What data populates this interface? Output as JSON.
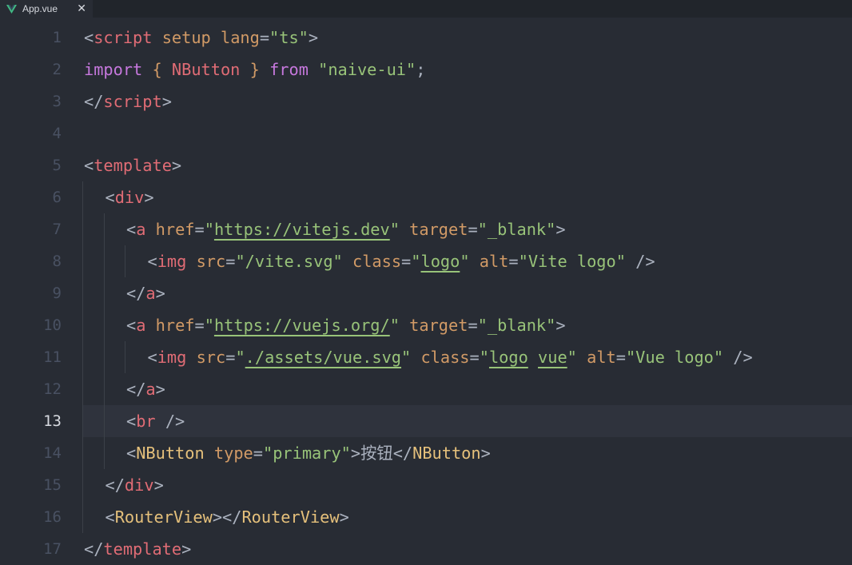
{
  "tab": {
    "filename": "App.vue",
    "close_glyph": "✕",
    "icon": "vue-icon"
  },
  "editor": {
    "current_line": 13,
    "lines": [
      {
        "n": "1",
        "indent": 0,
        "tokens": [
          [
            "pun",
            "<"
          ],
          [
            "tag",
            "script"
          ],
          [
            "pun",
            " "
          ],
          [
            "att",
            "setup"
          ],
          [
            "pun",
            " "
          ],
          [
            "att",
            "lang"
          ],
          [
            "pun",
            "="
          ],
          [
            "str",
            "\"ts\""
          ],
          [
            "pun",
            ">"
          ]
        ]
      },
      {
        "n": "2",
        "indent": 0,
        "tokens": [
          [
            "kw",
            "import"
          ],
          [
            "pun",
            " "
          ],
          [
            "att",
            "{"
          ],
          [
            "pun",
            " "
          ],
          [
            "tag",
            "NButton"
          ],
          [
            "pun",
            " "
          ],
          [
            "att",
            "}"
          ],
          [
            "pun",
            " "
          ],
          [
            "kw",
            "from"
          ],
          [
            "pun",
            " "
          ],
          [
            "str",
            "\"naive-ui\""
          ],
          [
            "pun",
            ";"
          ]
        ]
      },
      {
        "n": "3",
        "indent": 0,
        "tokens": [
          [
            "pun",
            "</"
          ],
          [
            "tag",
            "script"
          ],
          [
            "pun",
            ">"
          ]
        ]
      },
      {
        "n": "4",
        "indent": 0,
        "tokens": []
      },
      {
        "n": "5",
        "indent": 0,
        "tokens": [
          [
            "pun",
            "<"
          ],
          [
            "tag",
            "template"
          ],
          [
            "pun",
            ">"
          ]
        ]
      },
      {
        "n": "6",
        "indent": 1,
        "tokens": [
          [
            "pun",
            "<"
          ],
          [
            "tag",
            "div"
          ],
          [
            "pun",
            ">"
          ]
        ]
      },
      {
        "n": "7",
        "indent": 2,
        "tokens": [
          [
            "pun",
            "<"
          ],
          [
            "tag",
            "a"
          ],
          [
            "pun",
            " "
          ],
          [
            "att",
            "href"
          ],
          [
            "pun",
            "="
          ],
          [
            "str",
            "\""
          ],
          [
            "stru",
            "https://vitejs.dev"
          ],
          [
            "str",
            "\""
          ],
          [
            "pun",
            " "
          ],
          [
            "att",
            "target"
          ],
          [
            "pun",
            "="
          ],
          [
            "str",
            "\"_blank\""
          ],
          [
            "pun",
            ">"
          ]
        ]
      },
      {
        "n": "8",
        "indent": 3,
        "tokens": [
          [
            "pun",
            "<"
          ],
          [
            "tag",
            "img"
          ],
          [
            "pun",
            " "
          ],
          [
            "att",
            "src"
          ],
          [
            "pun",
            "="
          ],
          [
            "str",
            "\"/vite.svg\""
          ],
          [
            "pun",
            " "
          ],
          [
            "att",
            "class"
          ],
          [
            "pun",
            "="
          ],
          [
            "str",
            "\""
          ],
          [
            "stru",
            "logo"
          ],
          [
            "str",
            "\""
          ],
          [
            "pun",
            " "
          ],
          [
            "att",
            "alt"
          ],
          [
            "pun",
            "="
          ],
          [
            "str",
            "\"Vite logo\""
          ],
          [
            "pun",
            " />"
          ]
        ]
      },
      {
        "n": "9",
        "indent": 2,
        "tokens": [
          [
            "pun",
            "</"
          ],
          [
            "tag",
            "a"
          ],
          [
            "pun",
            ">"
          ]
        ]
      },
      {
        "n": "10",
        "indent": 2,
        "tokens": [
          [
            "pun",
            "<"
          ],
          [
            "tag",
            "a"
          ],
          [
            "pun",
            " "
          ],
          [
            "att",
            "href"
          ],
          [
            "pun",
            "="
          ],
          [
            "str",
            "\""
          ],
          [
            "stru",
            "https://vuejs.org/"
          ],
          [
            "str",
            "\""
          ],
          [
            "pun",
            " "
          ],
          [
            "att",
            "target"
          ],
          [
            "pun",
            "="
          ],
          [
            "str",
            "\"_blank\""
          ],
          [
            "pun",
            ">"
          ]
        ]
      },
      {
        "n": "11",
        "indent": 3,
        "tokens": [
          [
            "pun",
            "<"
          ],
          [
            "tag",
            "img"
          ],
          [
            "pun",
            " "
          ],
          [
            "att",
            "src"
          ],
          [
            "pun",
            "="
          ],
          [
            "str",
            "\""
          ],
          [
            "stru",
            "./assets/vue.svg"
          ],
          [
            "str",
            "\""
          ],
          [
            "pun",
            " "
          ],
          [
            "att",
            "class"
          ],
          [
            "pun",
            "="
          ],
          [
            "str",
            "\""
          ],
          [
            "stru",
            "logo"
          ],
          [
            "str",
            " "
          ],
          [
            "stru",
            "vue"
          ],
          [
            "str",
            "\""
          ],
          [
            "pun",
            " "
          ],
          [
            "att",
            "alt"
          ],
          [
            "pun",
            "="
          ],
          [
            "str",
            "\"Vue logo\""
          ],
          [
            "pun",
            " />"
          ]
        ]
      },
      {
        "n": "12",
        "indent": 2,
        "tokens": [
          [
            "pun",
            "</"
          ],
          [
            "tag",
            "a"
          ],
          [
            "pun",
            ">"
          ]
        ]
      },
      {
        "n": "13",
        "indent": 2,
        "tokens": [
          [
            "pun",
            "<"
          ],
          [
            "tag",
            "br"
          ],
          [
            "pun",
            " />"
          ]
        ]
      },
      {
        "n": "14",
        "indent": 2,
        "tokens": [
          [
            "pun",
            "<"
          ],
          [
            "cmp",
            "NButton"
          ],
          [
            "pun",
            " "
          ],
          [
            "att",
            "type"
          ],
          [
            "pun",
            "="
          ],
          [
            "str",
            "\"primary\""
          ],
          [
            "pun",
            ">"
          ],
          [
            "txt",
            "按钮"
          ],
          [
            "pun",
            "</"
          ],
          [
            "cmp",
            "NButton"
          ],
          [
            "pun",
            ">"
          ]
        ]
      },
      {
        "n": "15",
        "indent": 1,
        "tokens": [
          [
            "pun",
            "</"
          ],
          [
            "tag",
            "div"
          ],
          [
            "pun",
            ">"
          ]
        ]
      },
      {
        "n": "16",
        "indent": 1,
        "tokens": [
          [
            "pun",
            "<"
          ],
          [
            "cmp",
            "RouterView"
          ],
          [
            "pun",
            "></"
          ],
          [
            "cmp",
            "RouterView"
          ],
          [
            "pun",
            ">"
          ]
        ]
      },
      {
        "n": "17",
        "indent": 0,
        "tokens": [
          [
            "pun",
            "</"
          ],
          [
            "tag",
            "template"
          ],
          [
            "pun",
            ">"
          ]
        ]
      }
    ]
  },
  "colors": {
    "background": "#282c34",
    "tabbar": "#21252b",
    "current_line": "#2f333d",
    "tag": "#e06c75",
    "component": "#e5c07b",
    "attribute": "#d19a66",
    "string": "#98c379",
    "keyword": "#c678dd",
    "punctuation": "#abb2bf",
    "vue_green": "#41b883"
  }
}
